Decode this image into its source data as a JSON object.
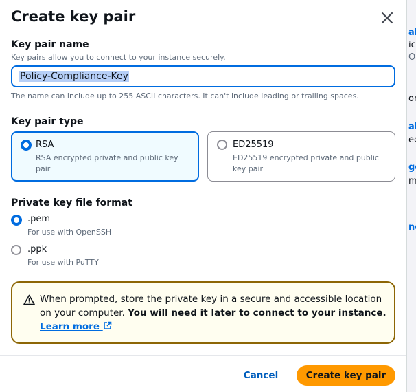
{
  "background_fragments": [
    "al",
    "ic",
    "Oc",
    "or",
    "al",
    "ec",
    "ge",
    "m",
    "ne"
  ],
  "modal": {
    "title": "Create key pair",
    "close_icon": "close-icon"
  },
  "key_pair_name": {
    "label": "Key pair name",
    "description": "Key pairs allow you to connect to your instance securely.",
    "value": "Policy-Compliance-Key",
    "constraint": "The name can include up to 255 ASCII characters. It can't include leading or trailing spaces."
  },
  "key_pair_type": {
    "label": "Key pair type",
    "options": [
      {
        "title": "RSA",
        "description": "RSA encrypted private and public key pair",
        "selected": true
      },
      {
        "title": "ED25519",
        "description": "ED25519 encrypted private and public key pair",
        "selected": false
      }
    ]
  },
  "file_format": {
    "label": "Private key file format",
    "options": [
      {
        "title": ".pem",
        "description": "For use with OpenSSH",
        "selected": true
      },
      {
        "title": ".ppk",
        "description": "For use with PuTTY",
        "selected": false
      }
    ]
  },
  "alert": {
    "icon": "warning-icon",
    "text_plain": "When prompted, store the private key in a secure and accessible location on your computer. ",
    "text_bold": "You will need it later to connect to your instance. ",
    "link": "Learn more",
    "link_icon": "external-link-icon"
  },
  "footer": {
    "cancel_label": "Cancel",
    "create_label": "Create key pair"
  },
  "colors": {
    "accent": "#006ce0",
    "primary_button": "#ff9900",
    "alert_border": "#8d6605",
    "alert_bg": "#fffef0",
    "selected_tile_bg": "#f0fbff"
  }
}
